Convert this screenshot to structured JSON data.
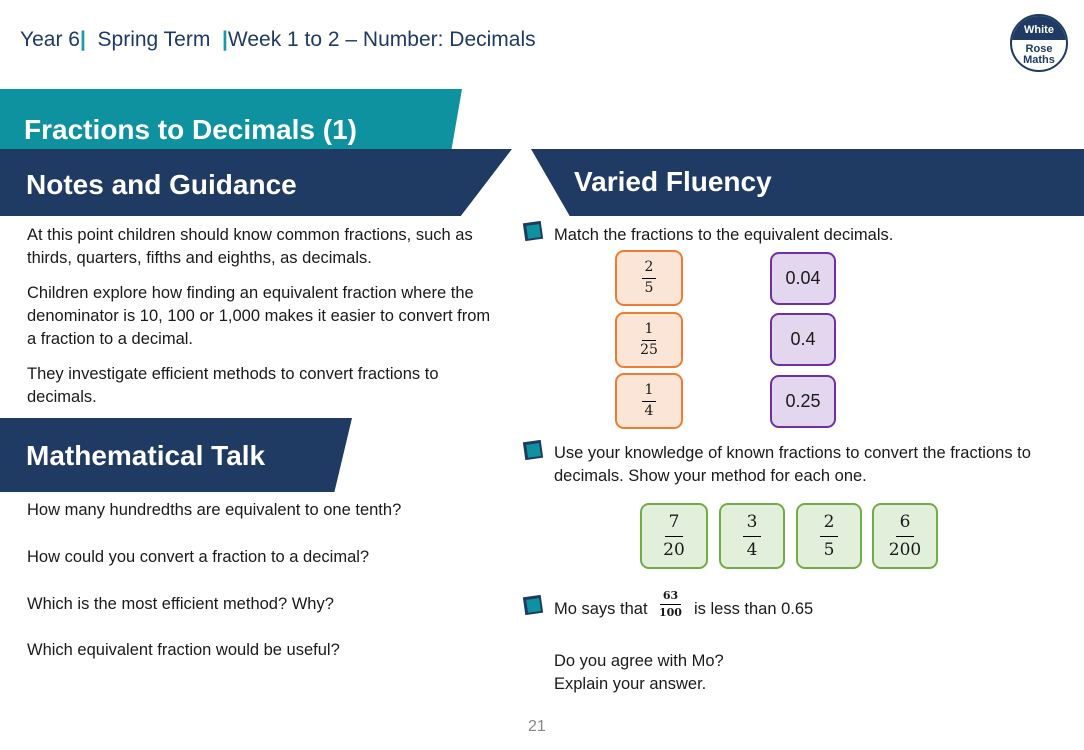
{
  "header": {
    "year": "Year 6",
    "term": "Spring Term",
    "week": "Week 1 to 2 – Number: Decimals",
    "separator": "|"
  },
  "logo": {
    "line1": "White",
    "line2": "Rose",
    "line3": "Maths"
  },
  "lesson_title": "Fractions to Decimals (1)",
  "notes": {
    "heading": "Notes and Guidance",
    "paragraphs": [
      "At this point children should know common fractions, such as thirds, quarters, fifths and eighths, as decimals.",
      "Children explore how finding an equivalent fraction where the denominator is 10, 100 or 1,000 makes it easier to convert from a fraction to a decimal.",
      "They investigate efficient methods to convert fractions to decimals."
    ]
  },
  "talk": {
    "heading": "Mathematical Talk",
    "questions": [
      "How many hundredths are equivalent to one tenth?",
      "How could you convert a fraction to a decimal?",
      "Which is the most efficient method? Why?",
      "Which equivalent fraction would be useful?"
    ]
  },
  "fluency": {
    "heading": "Varied Fluency",
    "q1": {
      "text": "Match the fractions to the equivalent decimals.",
      "fractions": [
        {
          "num": "2",
          "den": "5"
        },
        {
          "num": "1",
          "den": "25"
        },
        {
          "num": "1",
          "den": "4"
        }
      ],
      "decimals": [
        "0.04",
        "0.4",
        "0.25"
      ]
    },
    "q2": {
      "text": "Use your knowledge of known fractions to convert the fractions to decimals. Show your method for each one.",
      "fractions": [
        {
          "num": "7",
          "den": "20"
        },
        {
          "num": "3",
          "den": "4"
        },
        {
          "num": "2",
          "den": "5"
        },
        {
          "num": "6",
          "den": "200"
        }
      ]
    },
    "q3": {
      "prefix": "Mo says that",
      "fraction": {
        "num": "63",
        "den": "100"
      },
      "suffix": "is less than 0.65",
      "line2": "Do you agree with Mo?",
      "line3": "Explain your answer."
    }
  },
  "page_number": "21"
}
